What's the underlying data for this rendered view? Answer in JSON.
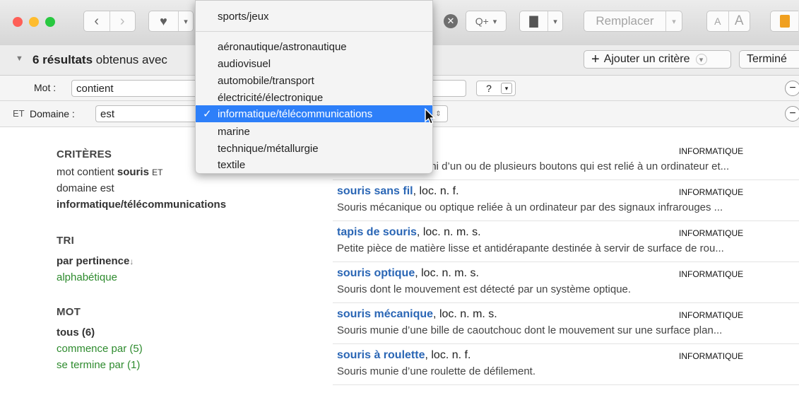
{
  "toolbar": {
    "replace_label": "Remplacer",
    "font_small": "A",
    "font_large": "A",
    "zoom_label": "Q+"
  },
  "results_bar": {
    "count_bold": "6 résultats",
    "count_rest": "obtenus avec",
    "add_criterion": "Ajouter un critère",
    "done": "Terminé"
  },
  "criteria": {
    "row1": {
      "field_label": "Mot :",
      "operator": "contient",
      "help": "?"
    },
    "row2": {
      "conjunction": "ET",
      "field_label": "Domaine :",
      "operator": "est"
    }
  },
  "sidebar": {
    "criteria_heading": "CRITÈRES",
    "crit_line1_a": "mot contient",
    "crit_line1_b": "souris",
    "crit_line1_c": "ET",
    "crit_line2": "domaine est",
    "crit_line3": "informatique/télécommunications",
    "sort_heading": "TRI",
    "sort_active": "par pertinence",
    "sort_arrow": "↓",
    "sort_other": "alphabétique",
    "word_heading": "MOT",
    "word_all": "tous (6)",
    "word_starts": "commence par (5)",
    "word_ends": "se termine par (1)"
  },
  "results": [
    {
      "term": "",
      "pos": "",
      "domain": "INFORMATIQUE",
      "definition": "uni d’un ou de plusieurs boutons qui est relié à un ordinateur et..."
    },
    {
      "term": "souris sans fil",
      "pos": ", loc. n. f.",
      "domain": "INFORMATIQUE",
      "definition": "Souris mécanique ou optique reliée à un ordinateur par des signaux infrarouges ..."
    },
    {
      "term": "tapis de souris",
      "pos": ", loc. n. m. s.",
      "domain": "INFORMATIQUE",
      "definition": "Petite pièce de matière lisse et antidérapante destinée à servir de surface de rou..."
    },
    {
      "term": "souris optique",
      "pos": ", loc. n. m. s.",
      "domain": "INFORMATIQUE",
      "definition": "Souris dont le mouvement est détecté par un système optique."
    },
    {
      "term": "souris mécanique",
      "pos": ", loc. n. m. s.",
      "domain": "INFORMATIQUE",
      "definition": "Souris munie d’une bille de caoutchouc dont le mouvement sur une surface plan..."
    },
    {
      "term": "souris à roulette",
      "pos": ", loc. n. f.",
      "domain": "INFORMATIQUE",
      "definition": "Souris munie d’une roulette de défilement."
    }
  ],
  "dropdown": {
    "items": [
      "sports/jeux",
      "aéronautique/astronautique",
      "audiovisuel",
      "automobile/transport",
      "électricité/électronique",
      "informatique/télécommunications",
      "marine",
      "technique/métallurgie",
      "textile"
    ],
    "selected_index": 5,
    "check": "✓"
  },
  "colors": {
    "accent": "#2d7ff9",
    "link": "#2a66b5",
    "green": "#2e8b2e",
    "close": "#fe5f57",
    "minimize": "#febc2e",
    "zoom": "#28c840"
  }
}
